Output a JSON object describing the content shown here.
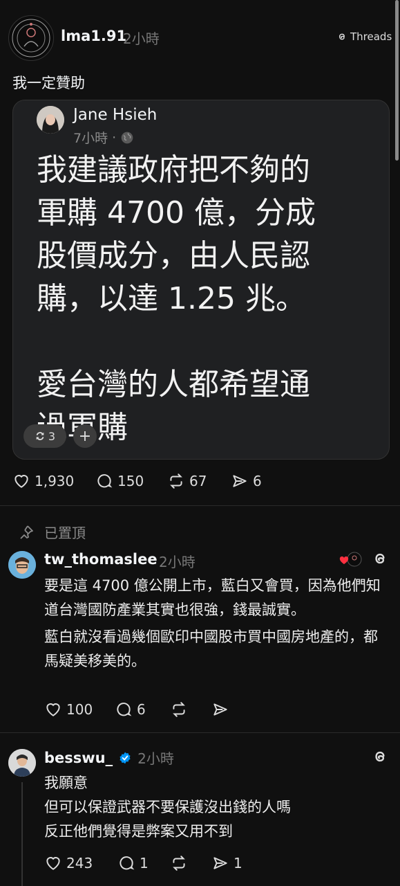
{
  "post": {
    "username": "lma1.91",
    "time": "2小時",
    "brand": "Threads",
    "text": "我一定贊助",
    "stats": {
      "likes": "1,930",
      "comments": "150",
      "reposts": "67",
      "shares": "6"
    }
  },
  "quote": {
    "author": "Jane Hsieh",
    "time": "7小時",
    "dot": "·",
    "lines": [
      "我建議政府把不夠的",
      "軍購 4700 億，分成",
      "股價成分，由人民認",
      "購，以達 1.25 兆。",
      "",
      "愛台灣的人都希望通",
      "過軍購"
    ],
    "repost_count": "3",
    "add_label": "+"
  },
  "pinned_label": "已置頂",
  "replies": [
    {
      "username": "tw_thomaslee",
      "time": "2小時",
      "paragraphs": [
        "要是這 4700 億公開上市，藍白又會買，因為他們知道台灣國防產業其實也很強，錢最誠實。",
        "藍白就沒看過幾個歐印中國股市買中國房地產的，都馬疑美移美的。"
      ],
      "stats": {
        "likes": "100",
        "comments": "6"
      }
    },
    {
      "username": "besswu_",
      "time": "2小時",
      "lines": [
        "我願意",
        "但可以保證武器不要保護沒出錢的人嗎",
        "反正他們覺得是弊案又用不到"
      ],
      "stats": {
        "likes": "243",
        "comments": "1",
        "shares": "1"
      }
    }
  ],
  "colors": {
    "verified": "#0095f6",
    "heart": "#ff3040"
  }
}
